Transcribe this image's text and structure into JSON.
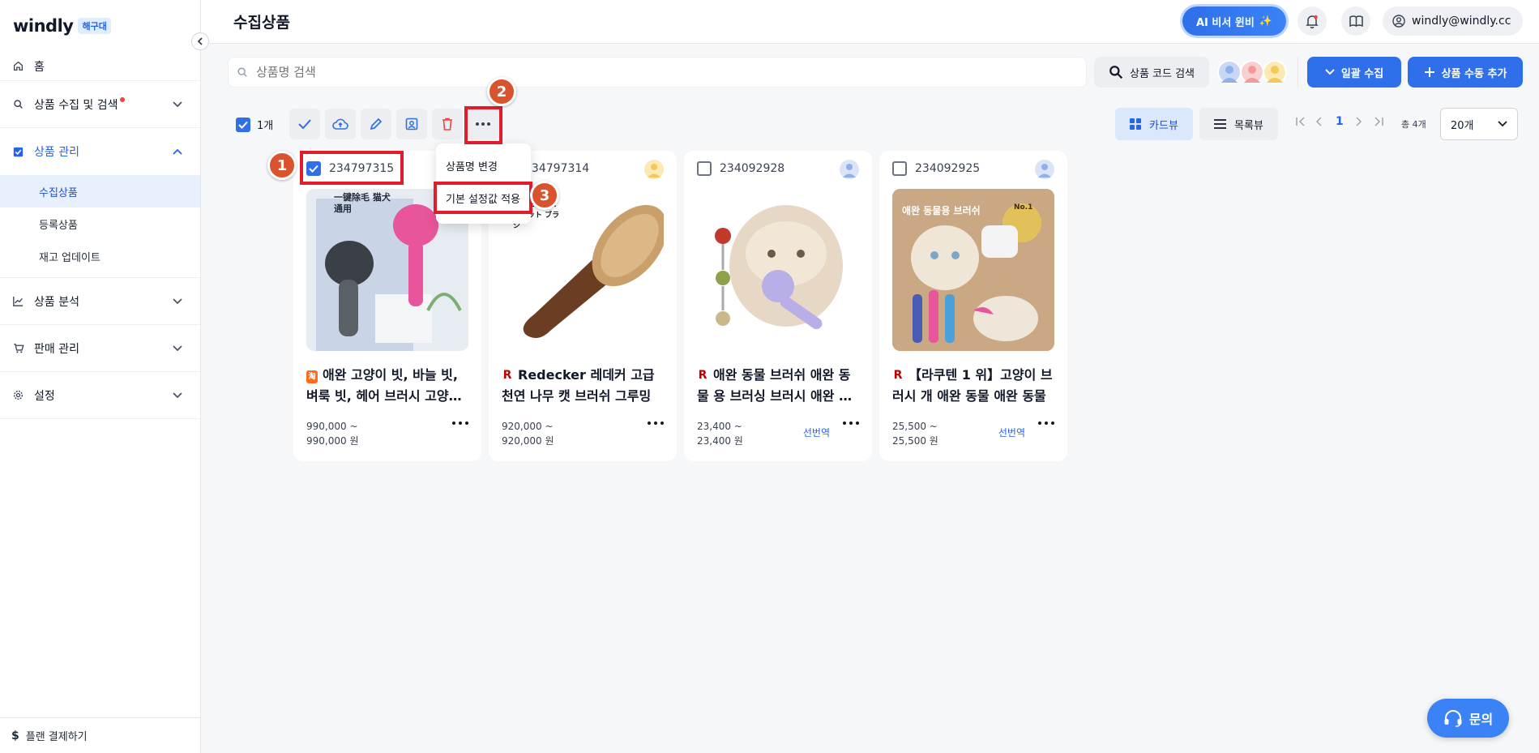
{
  "app": {
    "logo": "windly",
    "badge": "해구대",
    "page_title": "수집상품"
  },
  "sidebar": {
    "home": "홈",
    "sections": [
      {
        "label": "상품 수집 및 검색",
        "icon": "search-icon",
        "has_dot": true
      },
      {
        "label": "상품 관리",
        "icon": "checkbox-icon",
        "active": true
      },
      {
        "label": "상품 분석",
        "icon": "chart-icon"
      },
      {
        "label": "판매 관리",
        "icon": "cart-icon"
      },
      {
        "label": "설정",
        "icon": "gear-icon"
      }
    ],
    "sub_items": [
      "수집상품",
      "등록상품",
      "재고 업데이트"
    ],
    "plan": "플랜 결제하기"
  },
  "topbar": {
    "ai_button": "AI 비서 윈비",
    "user_email": "windly@windly.cc"
  },
  "search": {
    "placeholder": "상품명 검색",
    "code_search": "상품 코드 검색",
    "bulk_collect": "일괄 수집",
    "manual_add": "상품 수동 추가"
  },
  "toolbar": {
    "selected_count": "1개",
    "card_view": "카드뷰",
    "list_view": "목록뷰",
    "current_page": "1",
    "total": "총 4개",
    "per_page": "20개"
  },
  "dropdown": {
    "items": [
      "상품명 변경",
      "기본 설정값 적용"
    ]
  },
  "steps": [
    "1",
    "2",
    "3"
  ],
  "products": [
    {
      "code": "234797315",
      "checked": true,
      "source": "taobao",
      "title": "애완 고양이 빗, 바늘 빗, 벼룩 빗, 헤어 브러시 고양이 빗",
      "price_from": "990,000 ~",
      "price_to": "990,000 원",
      "translate": ""
    },
    {
      "code": "234797314",
      "checked": false,
      "source": "rakuten",
      "title": "Redecker 레데커 고급 천연 나무 캣 브러쉬 그루밍",
      "price_from": "920,000 ~",
      "price_to": "920,000 원",
      "translate": ""
    },
    {
      "code": "234092928",
      "checked": false,
      "source": "rakuten",
      "title": "애완 동물 브러쉬 애완 동물 용 브러싱 브러시 애완 동물",
      "price_from": "23,400 ~",
      "price_to": "23,400 원",
      "translate": "선번역"
    },
    {
      "code": "234092925",
      "checked": false,
      "source": "rakuten",
      "title": "【라쿠텐 1 위】고양이 브러시 개 애완 동물 애완 동물",
      "price_from": "25,500 ~",
      "price_to": "25,500 원",
      "translate": "선번역"
    }
  ],
  "image_text": {
    "p1": "一键除毛 猫犬通用",
    "p2": "REDECKER キャット ブラシ",
    "p4_top": "애완 동물용 브러쉬",
    "p4_badge": "No.1"
  },
  "ask_button": "문의",
  "colors": {
    "accent": "#2f6fe9",
    "highlight": "#e11d2a",
    "step": "#d9532e"
  }
}
